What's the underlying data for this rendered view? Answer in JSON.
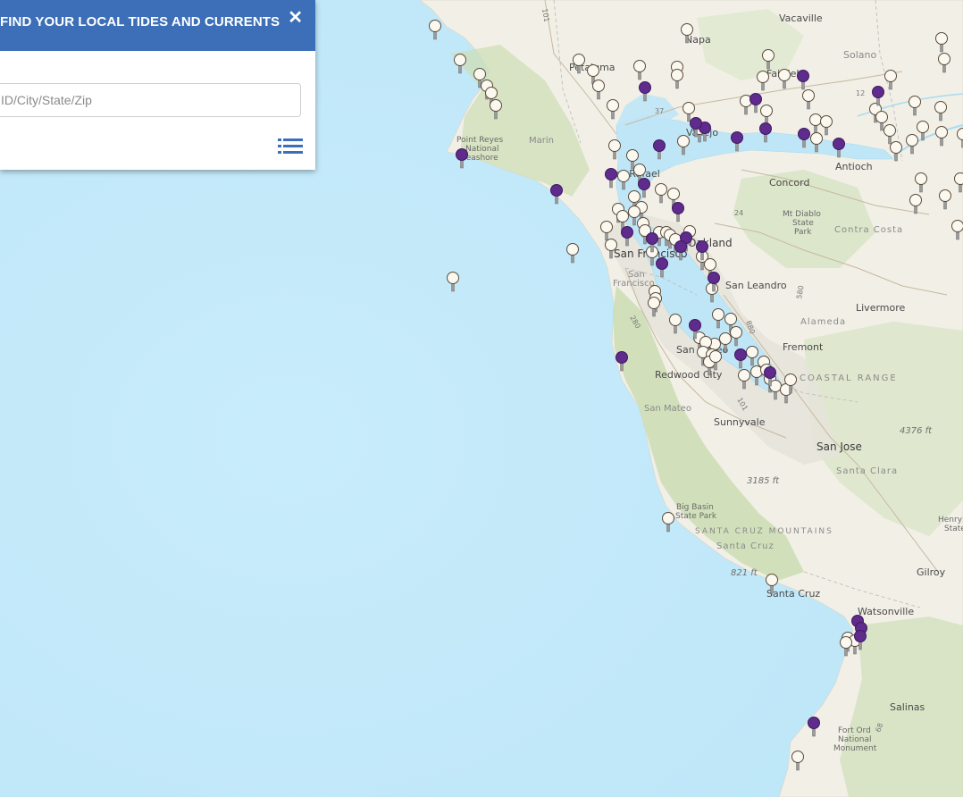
{
  "panel": {
    "title": "FIND YOUR LOCAL TIDES AND CURRENTS",
    "close_label": "✕",
    "search_placeholder": "ID/City/State/Zip"
  },
  "map_labels": {
    "vacaville": "Vacaville",
    "napa": "Napa",
    "petaluma": "Petaluma",
    "fairfield": "Fairfield",
    "solano": "Solano",
    "marin": "Marin",
    "point_reyes_1": "Point Reyes",
    "point_reyes_2": "National",
    "point_reyes_3": "Seashore",
    "vallejo": "Vallejo",
    "san_rafael": "San Rafael",
    "antioch": "Antioch",
    "concord": "Concord",
    "mt_diablo_1": "Mt Diablo",
    "mt_diablo_2": "State",
    "mt_diablo_3": "Park",
    "contra_costa": "Contra Costa",
    "san_francisco": "San Francisco",
    "oakland": "Oakland",
    "sf_county_1": "San",
    "sf_county_2": "Francisco",
    "san_leandro": "San Leandro",
    "livermore": "Livermore",
    "alameda": "Alameda",
    "fremont": "Fremont",
    "san_mateo_city": "San Mateo",
    "redwood_city": "Redwood City",
    "coastal_range": "COASTAL RANGE",
    "san_mateo_county": "San Mateo",
    "sunnyvale": "Sunnyvale",
    "san_jose": "San Jose",
    "santa_clara": "Santa Clara",
    "elev_4376": "4376 ft",
    "elev_3185": "3185 ft",
    "big_basin_1": "Big Basin",
    "big_basin_2": "State Park",
    "santa_cruz_mtns": "SANTA CRUZ MOUNTAINS",
    "santa_cruz_county": "Santa Cruz",
    "elev_821": "821 ft",
    "henry_1": "Henry",
    "henry_2": "State",
    "gilroy": "Gilroy",
    "santa_cruz_city": "Santa Cruz",
    "watsonville": "Watsonville",
    "salinas": "Salinas",
    "fort_ord_1": "Fort Ord",
    "fort_ord_2": "National",
    "fort_ord_3": "Monument",
    "hwy_101": "101",
    "hwy_37": "37",
    "hwy_12": "12",
    "hwy_24": "24",
    "hwy_580": "580",
    "hwy_880": "880",
    "hwy_280": "280",
    "hwy_101b": "101",
    "hwy_68": "68"
  },
  "colors": {
    "ocean": "#cdeefb",
    "land": "#f1efe6",
    "vegetation": "#c9dcb1",
    "bay_water": "#bfe6f7",
    "panel_header": "#3c6fb8",
    "tide_station_marker": "#fbf8f0",
    "current_station_marker": "#5f2b8c",
    "marker_stem": "#8d8d8d"
  },
  "legend": {
    "white_markers": "tide-station",
    "purple_markers": "current-station"
  }
}
